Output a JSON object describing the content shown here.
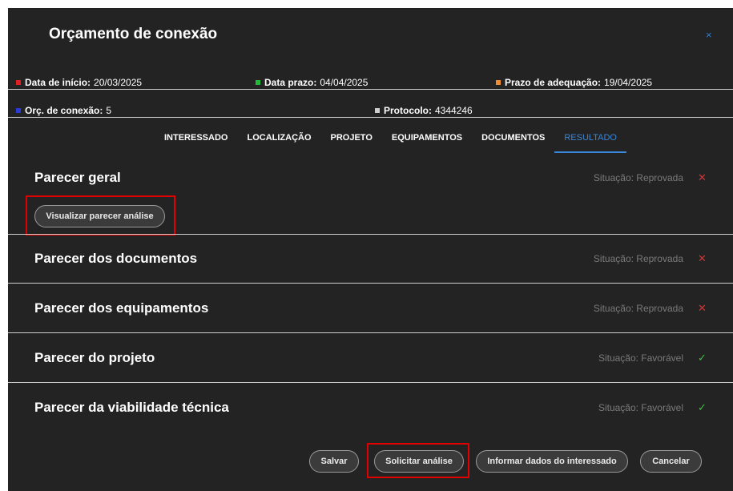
{
  "modal": {
    "title": "Orçamento de conexão",
    "close_icon": "×"
  },
  "info": {
    "data_inicio": {
      "label": "Data de início:",
      "value": "20/03/2025",
      "color": "#e02020"
    },
    "data_prazo": {
      "label": "Data prazo:",
      "value": "04/04/2025",
      "color": "#22b83a"
    },
    "prazo_adequacao": {
      "label": "Prazo de adequação:",
      "value": "19/04/2025",
      "color": "#f08a30"
    },
    "orc_conexao": {
      "label": "Orç. de conexão:",
      "value": "5",
      "color": "#2a3bd8"
    },
    "protocolo": {
      "label": "Protocolo:",
      "value": "4344246",
      "color": "#cfcfcf"
    }
  },
  "tabs": [
    "INTERESSADO",
    "LOCALIZAÇÃO",
    "PROJETO",
    "EQUIPAMENTOS",
    "DOCUMENTOS",
    "RESULTADO"
  ],
  "active_tab": "RESULTADO",
  "sections": [
    {
      "title": "Parecer geral",
      "status": "Situação: Reprovada",
      "mark": "✕",
      "state": "bad"
    },
    {
      "title": "Parecer dos documentos",
      "status": "Situação: Reprovada",
      "mark": "✕",
      "state": "bad"
    },
    {
      "title": "Parecer dos equipamentos",
      "status": "Situação: Reprovada",
      "mark": "✕",
      "state": "bad"
    },
    {
      "title": "Parecer do projeto",
      "status": "Situação: Favorável",
      "mark": "✓",
      "state": "good"
    },
    {
      "title": "Parecer da viabilidade técnica",
      "status": "Situação: Favorável",
      "mark": "✓",
      "state": "good"
    }
  ],
  "buttons": {
    "visualizar": "Visualizar parecer análise",
    "salvar": "Salvar",
    "solicitar": "Solicitar análise",
    "informar": "Informar dados do interessado",
    "cancelar": "Cancelar"
  },
  "colors": {
    "accent": "#3a86d8",
    "highlight": "#e00000",
    "bad": "#d83333",
    "good": "#3fbf3f"
  }
}
